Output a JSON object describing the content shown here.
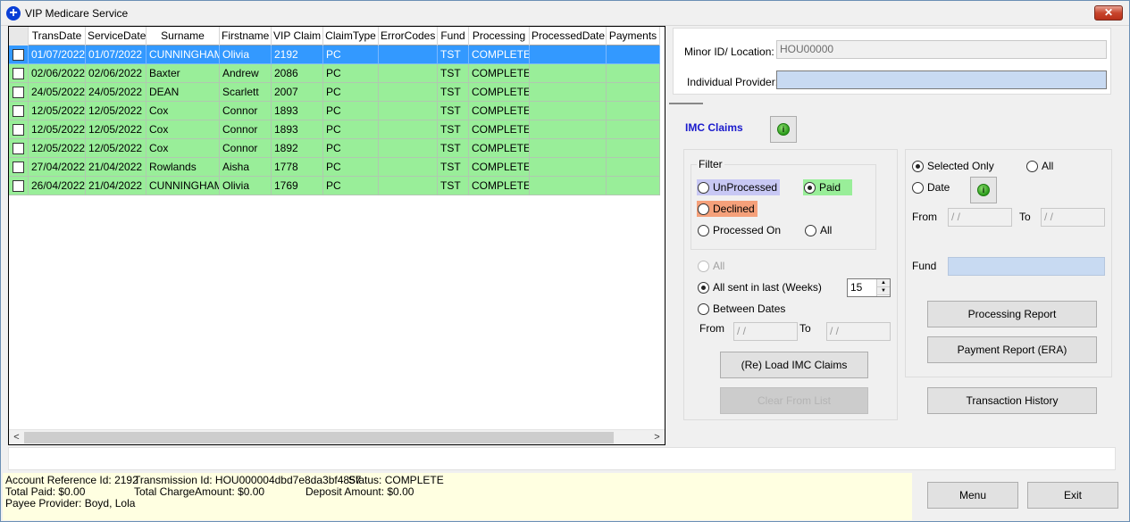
{
  "window": {
    "title": "VIP Medicare Service",
    "close_glyph": "✕",
    "app_icon": "+"
  },
  "grid": {
    "columns": [
      "",
      "TransDate",
      "ServiceDate",
      "Surname",
      "Firstname",
      "VIP Claim",
      "ClaimType",
      "ErrorCodes",
      "Fund",
      "Processing",
      "ProcessedDate",
      "Payments"
    ],
    "rows": [
      [
        "01/07/2022",
        "01/07/2022",
        "CUNNINGHAM",
        "Olivia",
        "2192",
        "PC",
        "",
        "TST",
        "COMPLETE",
        "",
        ""
      ],
      [
        "02/06/2022",
        "02/06/2022",
        "Baxter",
        "Andrew",
        "2086",
        "PC",
        "",
        "TST",
        "COMPLETE",
        "",
        ""
      ],
      [
        "24/05/2022",
        "24/05/2022",
        "DEAN",
        "Scarlett",
        "2007",
        "PC",
        "",
        "TST",
        "COMPLETE",
        "",
        ""
      ],
      [
        "12/05/2022",
        "12/05/2022",
        "Cox",
        "Connor",
        "1893",
        "PC",
        "",
        "TST",
        "COMPLETE",
        "",
        ""
      ],
      [
        "12/05/2022",
        "12/05/2022",
        "Cox",
        "Connor",
        "1893",
        "PC",
        "",
        "TST",
        "COMPLETE",
        "",
        ""
      ],
      [
        "12/05/2022",
        "12/05/2022",
        "Cox",
        "Connor",
        "1892",
        "PC",
        "",
        "TST",
        "COMPLETE",
        "",
        ""
      ],
      [
        "27/04/2022",
        "21/04/2022",
        "Rowlands",
        "Aisha",
        "1778",
        "PC",
        "",
        "TST",
        "COMPLETE",
        "",
        ""
      ],
      [
        "26/04/2022",
        "21/04/2022",
        "CUNNINGHAM",
        "Olivia",
        "1769",
        "PC",
        "",
        "TST",
        "COMPLETE",
        "",
        ""
      ]
    ],
    "selected_row": 0,
    "scroll_left": "<",
    "scroll_right": ">"
  },
  "provider": {
    "minor_id_label": "Minor ID/ Location:",
    "minor_id_value": "HOU00000",
    "individual_provider_label": "Individual Provider:",
    "individual_provider_value": ""
  },
  "imc": {
    "title": "IMC Claims",
    "info_glyph": "i",
    "filter_label": "Filter",
    "unprocessed": "UnProcessed",
    "paid": "Paid",
    "declined": "Declined",
    "processed_on": "Processed On",
    "filter_all": "All",
    "range_all": "All",
    "all_sent_in_last": "All sent in last (Weeks)",
    "weeks_value": "15",
    "between_dates": "Between Dates",
    "from_label": "From",
    "to_label": "To",
    "date_placeholder": " / /",
    "load_button": "(Re) Load IMC Claims",
    "clear_button": "Clear From List"
  },
  "report": {
    "selected_only": "Selected Only",
    "all": "All",
    "date": "Date",
    "from_label": "From",
    "to_label": "To",
    "date_placeholder": " / /",
    "fund_label": "Fund",
    "fund_value": "",
    "processing_report": "Processing Report",
    "payment_report": "Payment Report (ERA)",
    "transaction_history": "Transaction History"
  },
  "status": {
    "account_ref": "Account Reference Id: 2192",
    "transmission_id": "Transmission Id: HOU000004dbd7e8da3bf4857",
    "status": "Status: COMPLETE",
    "total_paid": "Total Paid: $0.00",
    "total_charge": "Total ChargeAmount: $0.00",
    "deposit": "Deposit Amount: $0.00",
    "payee": "Payee Provider: Boyd, Lola"
  },
  "footer": {
    "menu": "Menu",
    "exit": "Exit"
  },
  "colors": {
    "row_green": "#99ee99",
    "row_selected": "#3399ff",
    "imc_title": "#1a1acc",
    "declined": "#f5a07a",
    "unprocessed": "#c8c8f4",
    "status_bg": "#ffffe1"
  }
}
